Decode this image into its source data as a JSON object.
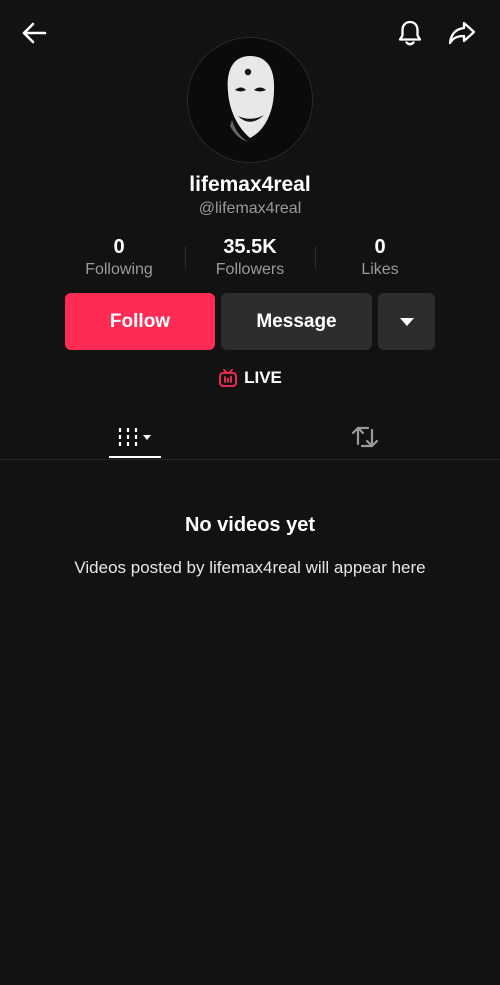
{
  "header": {
    "back_icon": "arrow-left-icon",
    "bell_icon": "bell-icon",
    "share_icon": "share-arrow-icon"
  },
  "profile": {
    "avatar_icon": "white-mask-face-avatar",
    "display_name": "lifemax4real",
    "handle": "@lifemax4real"
  },
  "stats": [
    {
      "value": "0",
      "label": "Following"
    },
    {
      "value": "35.5K",
      "label": "Followers"
    },
    {
      "value": "0",
      "label": "Likes"
    }
  ],
  "actions": {
    "follow_label": "Follow",
    "message_label": "Message",
    "more_icon": "caret-down-icon"
  },
  "live": {
    "icon": "tv-live-icon",
    "label": "LIVE"
  },
  "tabs": [
    {
      "icon": "grid-videos-icon",
      "selected": true
    },
    {
      "icon": "repost-icon",
      "selected": false
    }
  ],
  "empty_state": {
    "title": "No videos yet",
    "description": "Videos posted by lifemax4real will appear here"
  },
  "colors": {
    "background": "#121212",
    "accent": "#fe2c55",
    "secondary_button": "#2d2d2d",
    "muted_text": "#9a9a9a"
  }
}
